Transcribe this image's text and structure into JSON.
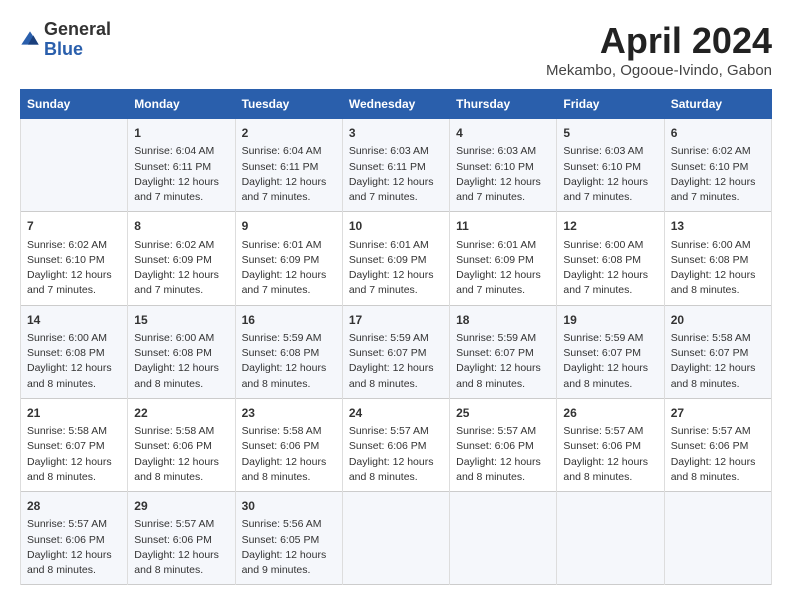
{
  "header": {
    "logo_general": "General",
    "logo_blue": "Blue",
    "title": "April 2024",
    "subtitle": "Mekambo, Ogooue-Ivindo, Gabon"
  },
  "weekdays": [
    "Sunday",
    "Monday",
    "Tuesday",
    "Wednesday",
    "Thursday",
    "Friday",
    "Saturday"
  ],
  "weeks": [
    [
      {
        "day": "",
        "info": ""
      },
      {
        "day": "1",
        "info": "Sunrise: 6:04 AM\nSunset: 6:11 PM\nDaylight: 12 hours\nand 7 minutes."
      },
      {
        "day": "2",
        "info": "Sunrise: 6:04 AM\nSunset: 6:11 PM\nDaylight: 12 hours\nand 7 minutes."
      },
      {
        "day": "3",
        "info": "Sunrise: 6:03 AM\nSunset: 6:11 PM\nDaylight: 12 hours\nand 7 minutes."
      },
      {
        "day": "4",
        "info": "Sunrise: 6:03 AM\nSunset: 6:10 PM\nDaylight: 12 hours\nand 7 minutes."
      },
      {
        "day": "5",
        "info": "Sunrise: 6:03 AM\nSunset: 6:10 PM\nDaylight: 12 hours\nand 7 minutes."
      },
      {
        "day": "6",
        "info": "Sunrise: 6:02 AM\nSunset: 6:10 PM\nDaylight: 12 hours\nand 7 minutes."
      }
    ],
    [
      {
        "day": "7",
        "info": "Sunrise: 6:02 AM\nSunset: 6:10 PM\nDaylight: 12 hours\nand 7 minutes."
      },
      {
        "day": "8",
        "info": "Sunrise: 6:02 AM\nSunset: 6:09 PM\nDaylight: 12 hours\nand 7 minutes."
      },
      {
        "day": "9",
        "info": "Sunrise: 6:01 AM\nSunset: 6:09 PM\nDaylight: 12 hours\nand 7 minutes."
      },
      {
        "day": "10",
        "info": "Sunrise: 6:01 AM\nSunset: 6:09 PM\nDaylight: 12 hours\nand 7 minutes."
      },
      {
        "day": "11",
        "info": "Sunrise: 6:01 AM\nSunset: 6:09 PM\nDaylight: 12 hours\nand 7 minutes."
      },
      {
        "day": "12",
        "info": "Sunrise: 6:00 AM\nSunset: 6:08 PM\nDaylight: 12 hours\nand 7 minutes."
      },
      {
        "day": "13",
        "info": "Sunrise: 6:00 AM\nSunset: 6:08 PM\nDaylight: 12 hours\nand 8 minutes."
      }
    ],
    [
      {
        "day": "14",
        "info": "Sunrise: 6:00 AM\nSunset: 6:08 PM\nDaylight: 12 hours\nand 8 minutes."
      },
      {
        "day": "15",
        "info": "Sunrise: 6:00 AM\nSunset: 6:08 PM\nDaylight: 12 hours\nand 8 minutes."
      },
      {
        "day": "16",
        "info": "Sunrise: 5:59 AM\nSunset: 6:08 PM\nDaylight: 12 hours\nand 8 minutes."
      },
      {
        "day": "17",
        "info": "Sunrise: 5:59 AM\nSunset: 6:07 PM\nDaylight: 12 hours\nand 8 minutes."
      },
      {
        "day": "18",
        "info": "Sunrise: 5:59 AM\nSunset: 6:07 PM\nDaylight: 12 hours\nand 8 minutes."
      },
      {
        "day": "19",
        "info": "Sunrise: 5:59 AM\nSunset: 6:07 PM\nDaylight: 12 hours\nand 8 minutes."
      },
      {
        "day": "20",
        "info": "Sunrise: 5:58 AM\nSunset: 6:07 PM\nDaylight: 12 hours\nand 8 minutes."
      }
    ],
    [
      {
        "day": "21",
        "info": "Sunrise: 5:58 AM\nSunset: 6:07 PM\nDaylight: 12 hours\nand 8 minutes."
      },
      {
        "day": "22",
        "info": "Sunrise: 5:58 AM\nSunset: 6:06 PM\nDaylight: 12 hours\nand 8 minutes."
      },
      {
        "day": "23",
        "info": "Sunrise: 5:58 AM\nSunset: 6:06 PM\nDaylight: 12 hours\nand 8 minutes."
      },
      {
        "day": "24",
        "info": "Sunrise: 5:57 AM\nSunset: 6:06 PM\nDaylight: 12 hours\nand 8 minutes."
      },
      {
        "day": "25",
        "info": "Sunrise: 5:57 AM\nSunset: 6:06 PM\nDaylight: 12 hours\nand 8 minutes."
      },
      {
        "day": "26",
        "info": "Sunrise: 5:57 AM\nSunset: 6:06 PM\nDaylight: 12 hours\nand 8 minutes."
      },
      {
        "day": "27",
        "info": "Sunrise: 5:57 AM\nSunset: 6:06 PM\nDaylight: 12 hours\nand 8 minutes."
      }
    ],
    [
      {
        "day": "28",
        "info": "Sunrise: 5:57 AM\nSunset: 6:06 PM\nDaylight: 12 hours\nand 8 minutes."
      },
      {
        "day": "29",
        "info": "Sunrise: 5:57 AM\nSunset: 6:06 PM\nDaylight: 12 hours\nand 8 minutes."
      },
      {
        "day": "30",
        "info": "Sunrise: 5:56 AM\nSunset: 6:05 PM\nDaylight: 12 hours\nand 9 minutes."
      },
      {
        "day": "",
        "info": ""
      },
      {
        "day": "",
        "info": ""
      },
      {
        "day": "",
        "info": ""
      },
      {
        "day": "",
        "info": ""
      }
    ]
  ]
}
